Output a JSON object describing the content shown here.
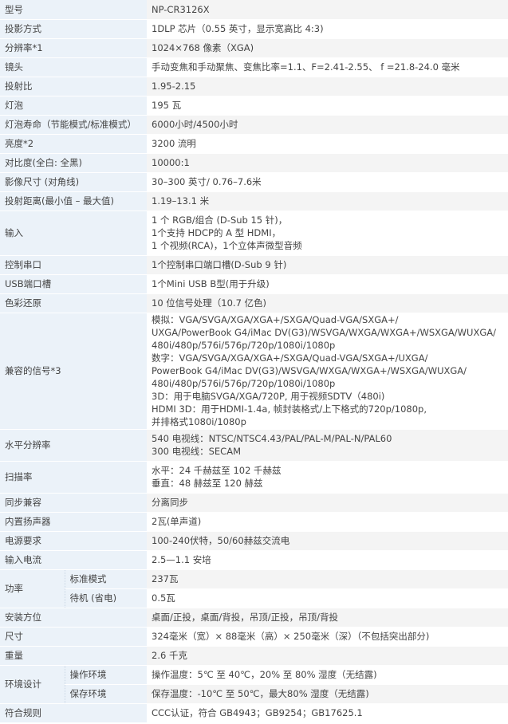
{
  "rows": [
    {
      "label": "型号",
      "value": [
        "NP-CR3126X"
      ],
      "h": 24
    },
    {
      "label": "投影方式",
      "value": [
        "1DLP 芯片（0.55 英寸，显示宽高比 4:3)"
      ],
      "h": 24
    },
    {
      "label": "分辨率*1",
      "value": [
        "1024×768 像素（XGA)"
      ],
      "h": 24
    },
    {
      "label": "镜头",
      "value": [
        "手动变焦和手动聚焦、变焦比率=1.1、F=2.41-2.55、 f =21.8-24.0 毫米"
      ],
      "h": 24
    },
    {
      "label": "投射比",
      "value": [
        "1.95-2.15"
      ],
      "h": 24
    },
    {
      "label": "灯泡",
      "value": [
        "195 瓦"
      ],
      "h": 24
    },
    {
      "label": "灯泡寿命（节能模式/标准模式）",
      "value": [
        "6000小时/4500小时"
      ],
      "h": 24
    },
    {
      "label": "亮度*2",
      "value": [
        "3200 流明"
      ],
      "h": 24
    },
    {
      "label": "对比度(全白: 全黑)",
      "value": [
        "10000:1"
      ],
      "h": 24
    },
    {
      "label": "影像尺寸 (对角线)",
      "value": [
        "30–300 英寸/ 0.76–7.6米"
      ],
      "h": 24
    },
    {
      "label": "投射距离(最小值 – 最大值)",
      "value": [
        "1.19–13.1 米"
      ],
      "h": 24
    },
    {
      "label": "输入",
      "value": [
        "1 个 RGB/组合 (D-Sub 15 针)，",
        "1个支持 HDCP的 A 型 HDMI，",
        "1 个视频(RCA)，1个立体声微型音频"
      ],
      "h": 56
    },
    {
      "label": "控制串口",
      "value": [
        "1个控制串口端口槽(D-Sub 9 针)"
      ],
      "h": 24
    },
    {
      "label": "USB端口槽",
      "value": [
        "1个Mini USB B型(用于升级)"
      ],
      "h": 24
    },
    {
      "label": "色彩还原",
      "value": [
        "10 位信号处理（10.7 亿色)"
      ],
      "h": 24
    },
    {
      "label": "兼容的信号*3",
      "value": [
        "模拟：VGA/SVGA/XGA/XGA+/SXGA/Quad-VGA/SXGA+/",
        "UXGA/PowerBook G4/iMac DV(G3)/WSVGA/WXGA/WXGA+/WSXGA/WUXGA/",
        "480i/480p/576i/576p/720p/1080i/1080p",
        "数字：VGA/SVGA/XGA/XGA+/SXGA/Quad-VGA/SXGA+/UXGA/",
        "PowerBook G4/iMac DV(G3)/WSVGA/WXGA/WXGA+/WSXGA/WUXGA/",
        "480i/480p/576i/576p/720p/1080i/1080p",
        "3D：用于电脑SVGA/XGA/720P, 用于视频SDTV（480i)",
        "HDMI 3D：用于HDMI-1.4a, 帧封装格式/上下格式的720p/1080p,",
        "并排格式1080i/1080p"
      ],
      "h": 146
    },
    {
      "label": "水平分辨率",
      "value": [
        "540 电视线：NTSC/NTSC4.43/PAL/PAL-M/PAL-N/PAL60",
        "300 电视线：SECAM"
      ],
      "h": 40
    },
    {
      "label": "扫描率",
      "value": [
        "水平：24 千赫兹至 102 千赫兹",
        "垂直：48 赫兹至 120 赫兹"
      ],
      "h": 40
    },
    {
      "label": "同步兼容",
      "value": [
        "分离同步"
      ],
      "h": 24
    },
    {
      "label": "内置扬声器",
      "value": [
        "2瓦(单声道)"
      ],
      "h": 24
    },
    {
      "label": "电源要求",
      "value": [
        "100-240伏特，50/60赫兹交流电"
      ],
      "h": 24
    },
    {
      "label": "输入电流",
      "value": [
        "2.5—1.1 安培"
      ],
      "h": 24
    }
  ],
  "power": {
    "label": "功率",
    "subs": [
      {
        "label": "标准模式",
        "value": "237瓦"
      },
      {
        "label": "待机 (省电)",
        "value": "0.5瓦"
      }
    ]
  },
  "rows2": [
    {
      "label": "安装方位",
      "value": [
        "桌面/正投，桌面/背投，吊顶/正投，吊顶/背投"
      ],
      "h": 24
    },
    {
      "label": "尺寸",
      "value": [
        "324毫米（宽）× 88毫米（高）× 250毫米（深）（不包括突出部分)"
      ],
      "h": 24
    },
    {
      "label": "重量",
      "value": [
        "2.6 千克"
      ],
      "h": 24
    }
  ],
  "env": {
    "label": "环境设计",
    "subs": [
      {
        "label": "操作环境",
        "value": "操作温度：5℃ 至 40℃，20% 至 80% 湿度（无结露)"
      },
      {
        "label": "保存环境",
        "value": "保存温度：-10℃ 至 50℃，最大80% 湿度（无结露)"
      }
    ]
  },
  "rows3": [
    {
      "label": "符合规则",
      "value": [
        "CCC认证，符合 GB4943；GB9254；GB17625.1"
      ],
      "h": 24
    }
  ]
}
